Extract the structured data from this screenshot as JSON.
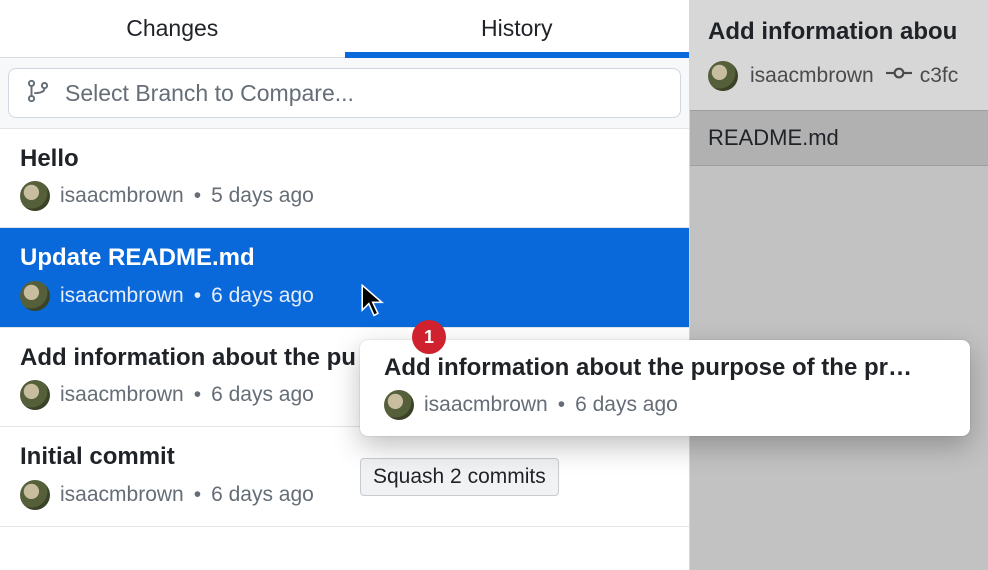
{
  "tabs": {
    "changes": "Changes",
    "history": "History"
  },
  "branch_compare": {
    "placeholder": "Select Branch to Compare..."
  },
  "commits": [
    {
      "title": "Hello",
      "author": "isaacmbrown",
      "time": "5 days ago",
      "selected": false
    },
    {
      "title": "Update README.md",
      "author": "isaacmbrown",
      "time": "6 days ago",
      "selected": true
    },
    {
      "title": "Add information about the pu",
      "author": "isaacmbrown",
      "time": "6 days ago",
      "selected": false
    },
    {
      "title": "Initial commit",
      "author": "isaacmbrown",
      "time": "6 days ago",
      "selected": false
    }
  ],
  "drag": {
    "badge": "1",
    "title": "Add information about the purpose of the pr…",
    "author": "isaacmbrown",
    "time": "6 days ago"
  },
  "squash_tooltip": "Squash 2 commits",
  "detail": {
    "title": "Add information abou",
    "author": "isaacmbrown",
    "hash": "c3fc",
    "file": "README.md"
  }
}
